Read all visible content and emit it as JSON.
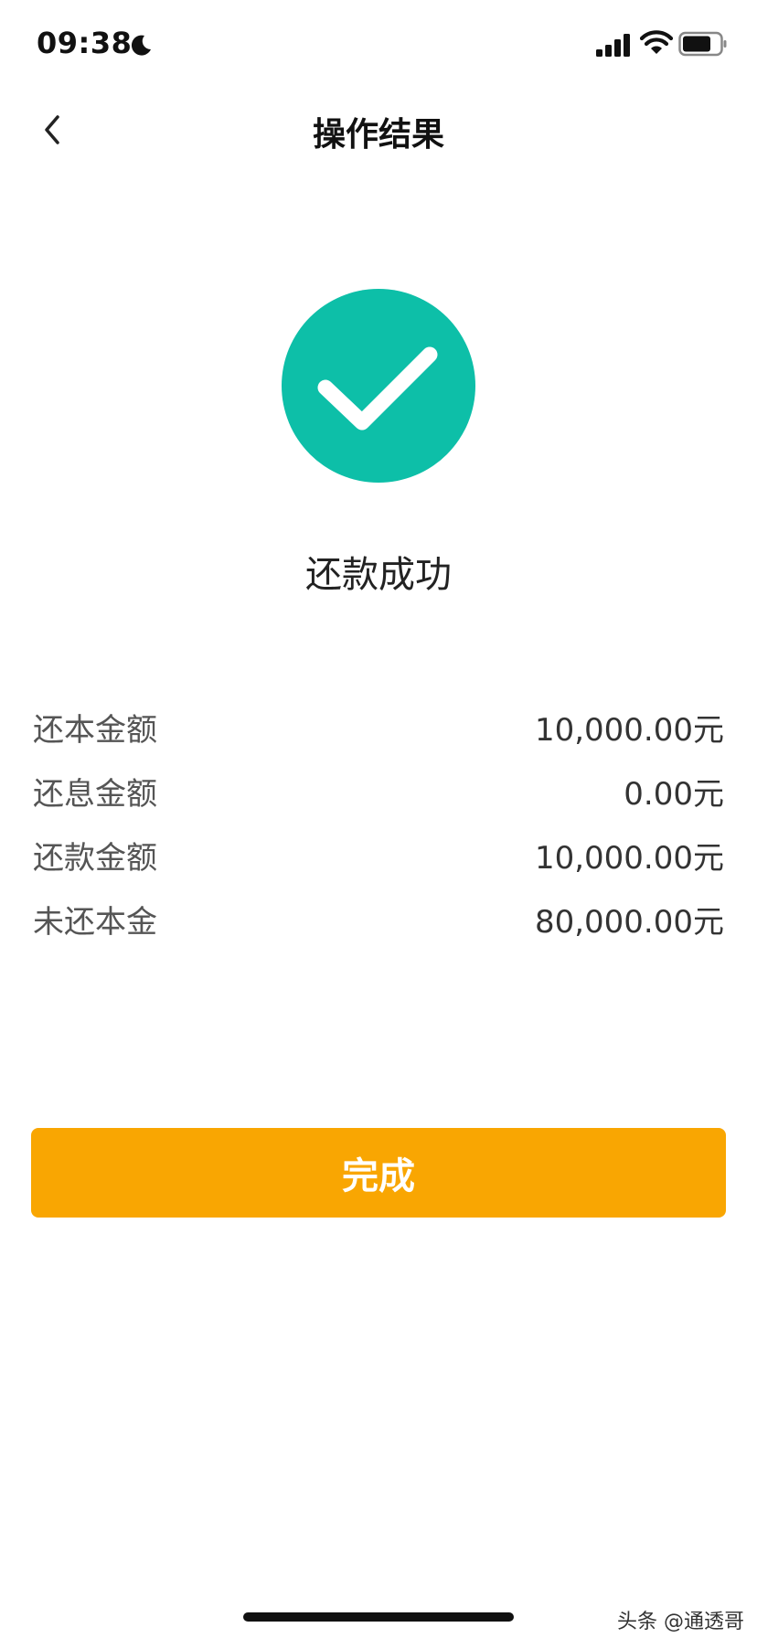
{
  "status_bar": {
    "time": "09:38",
    "icons": [
      "moon-icon",
      "signal-icon",
      "wifi-icon",
      "battery-icon"
    ]
  },
  "nav": {
    "back_icon": "chevron-left-icon",
    "title": "操作结果"
  },
  "result": {
    "icon": "check-circle-icon",
    "icon_color": "#0dbfa8",
    "message": "还款成功"
  },
  "details": [
    {
      "label": "还本金额",
      "value": "10,000.00元"
    },
    {
      "label": "还息金额",
      "value": "0.00元"
    },
    {
      "label": "还款金额",
      "value": "10,000.00元"
    },
    {
      "label": "未还本金",
      "value": "80,000.00元"
    }
  ],
  "actions": {
    "done_label": "完成",
    "done_color": "#f9a602"
  },
  "watermark": "头条 @通透哥"
}
